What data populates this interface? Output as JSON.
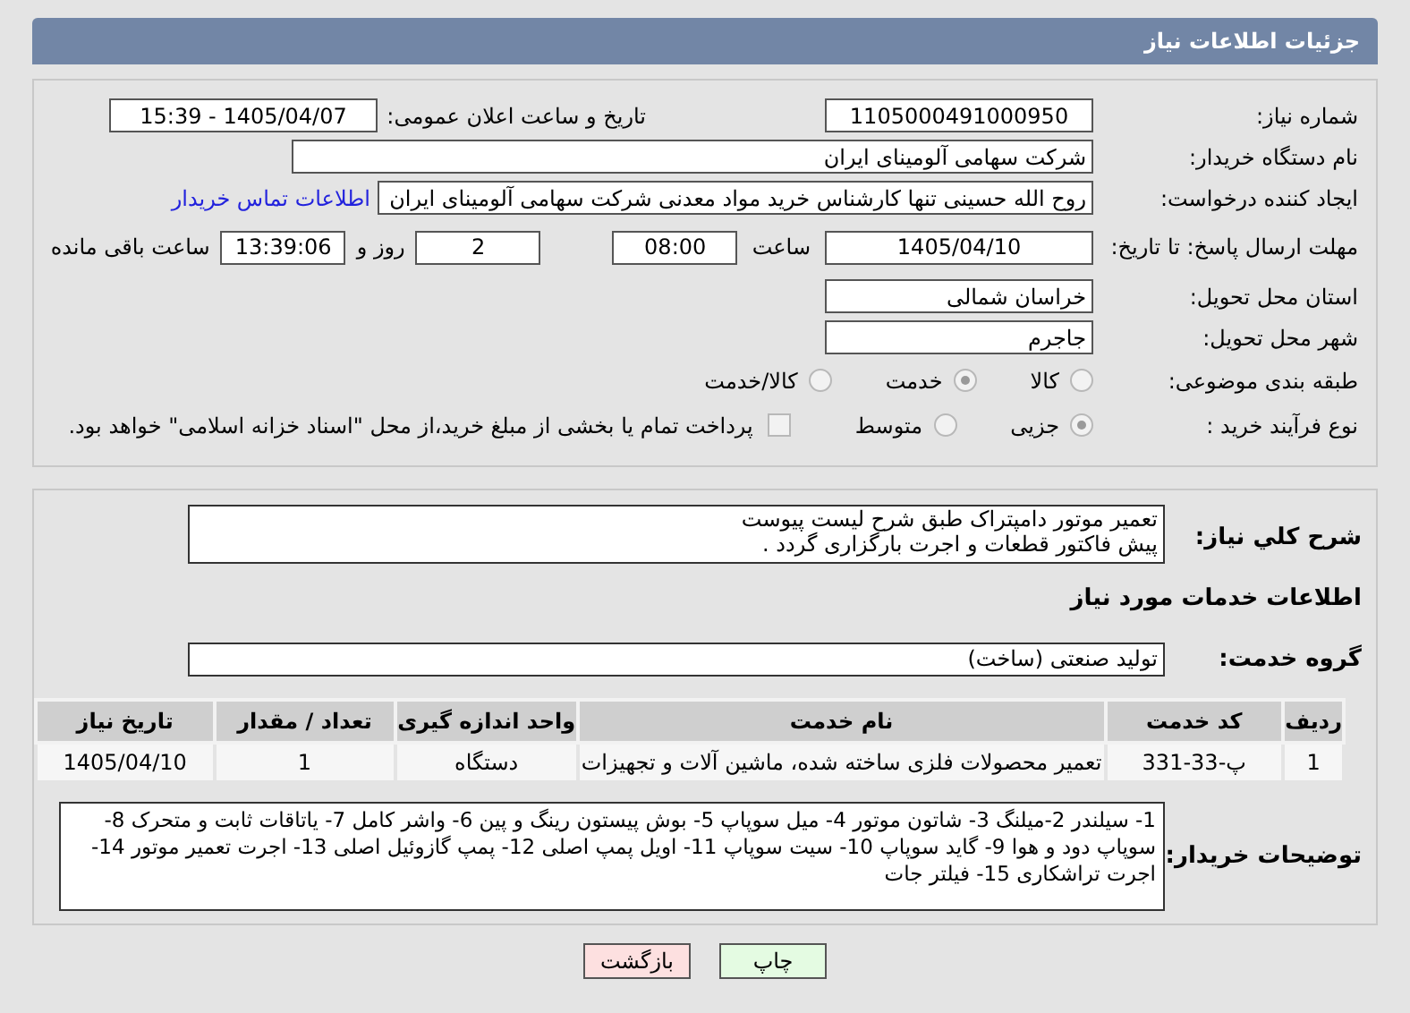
{
  "header": {
    "title": "جزئیات اطلاعات نیاز"
  },
  "form": {
    "need_number": {
      "label": "شماره نیاز:",
      "value": "1105000491000950"
    },
    "announce": {
      "label": "تاریخ و ساعت اعلان عمومی:",
      "value": "1405/04/07 - 15:39"
    },
    "buyer": {
      "label": "نام دستگاه خریدار:",
      "value": "شرکت سهامی آلومینای ایران"
    },
    "creator": {
      "label": "ایجاد کننده درخواست:",
      "value": "روح الله حسینی تنها کارشناس خرید مواد معدنی شرکت سهامی آلومینای ایران",
      "link": "اطلاعات تماس خریدار"
    },
    "deadline": {
      "label": "مهلت ارسال پاسخ: تا تاریخ:",
      "date": "1405/04/10",
      "time_label": "ساعت",
      "time": "08:00",
      "days": "2",
      "days_label": "روز و",
      "remaining": "13:39:06",
      "remaining_label": "ساعت باقی مانده"
    },
    "province": {
      "label": "استان محل تحویل:",
      "value": "خراسان شمالی"
    },
    "city": {
      "label": "شهر محل تحویل:",
      "value": "جاجرم"
    },
    "category": {
      "label": "طبقه بندی موضوعی:",
      "options": [
        {
          "label": "کالا",
          "selected": false
        },
        {
          "label": "خدمت",
          "selected": true
        },
        {
          "label": "کالا/خدمت",
          "selected": false
        }
      ]
    },
    "process": {
      "label": "نوع فرآیند خرید :",
      "options": [
        {
          "label": "جزیی",
          "selected": true
        },
        {
          "label": "متوسط",
          "selected": false
        }
      ],
      "payment": {
        "label": "پرداخت تمام یا بخشی از مبلغ خرید،از محل \"اسناد خزانه اسلامی\" خواهد بود.",
        "checked": false
      }
    }
  },
  "details": {
    "summary": {
      "label": "شرح کلي نياز:",
      "value": "تعمیر موتور دامپتراک طبق شرح لیست پیوست\nپیش فاکتور قطعات و اجرت بارگزاری گردد ."
    },
    "services_title": "اطلاعات خدمات مورد نیاز",
    "service_group": {
      "label": "گروه خدمت:",
      "value": "تولید صنعتی (ساخت)"
    },
    "table": {
      "columns": [
        "ردیف",
        "کد خدمت",
        "نام خدمت",
        "واحد اندازه گیری",
        "تعداد / مقدار",
        "تاریخ نیاز"
      ],
      "rows": [
        [
          "1",
          "پ-33-331",
          "تعمیر محصولات فلزی ساخته شده، ماشین آلات و تجهیزات",
          "دستگاه",
          "1",
          "1405/04/10"
        ]
      ]
    },
    "notes": {
      "label": "توضیحات خریدار:",
      "value": "1- سیلندر 2-میلنگ 3- شاتون موتور 4- میل سوپاپ 5- بوش پیستون رینگ و پین 6- واشر کامل 7- یاتاقات ثابت و متحرک 8- سوپاپ دود و هوا 9- گاید سوپاپ 10- سیت سوپاپ 11- اویل پمپ اصلی 12- پمپ گازوئیل اصلی 13- اجرت تعمیر موتور 14- اجرت تراشکاری 15- فیلتر جات"
    }
  },
  "buttons": [
    {
      "label": "چاپ",
      "kind": "print"
    },
    {
      "label": "بازگشت",
      "kind": "back"
    }
  ]
}
